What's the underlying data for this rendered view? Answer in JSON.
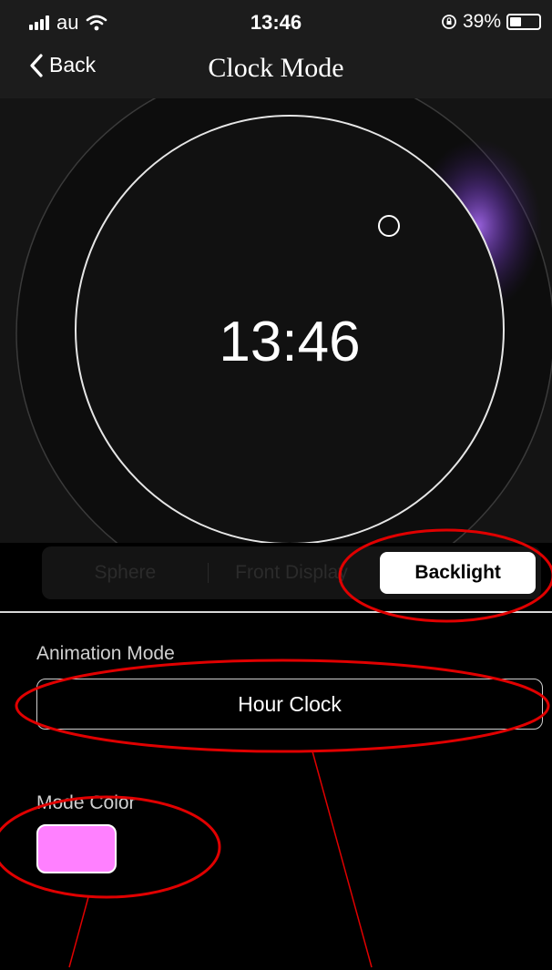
{
  "status_bar": {
    "carrier": "au",
    "time": "13:46",
    "battery_text": "39%"
  },
  "nav": {
    "back_label": "Back",
    "title": "Clock Mode"
  },
  "preview": {
    "clock_time": "13:46"
  },
  "segments": [
    {
      "label": "Sphere",
      "selected": false
    },
    {
      "label": "Front Display",
      "selected": false
    },
    {
      "label": "Backlight",
      "selected": true
    }
  ],
  "animation_mode": {
    "label": "Animation Mode",
    "value": "Hour Clock"
  },
  "mode_color": {
    "label": "Mode Color",
    "color": "#ff80ff"
  },
  "colors": {
    "background": "#000000",
    "bar": "#1c1c1c",
    "annotation": "#e00000",
    "glow": "#9b4dff"
  }
}
